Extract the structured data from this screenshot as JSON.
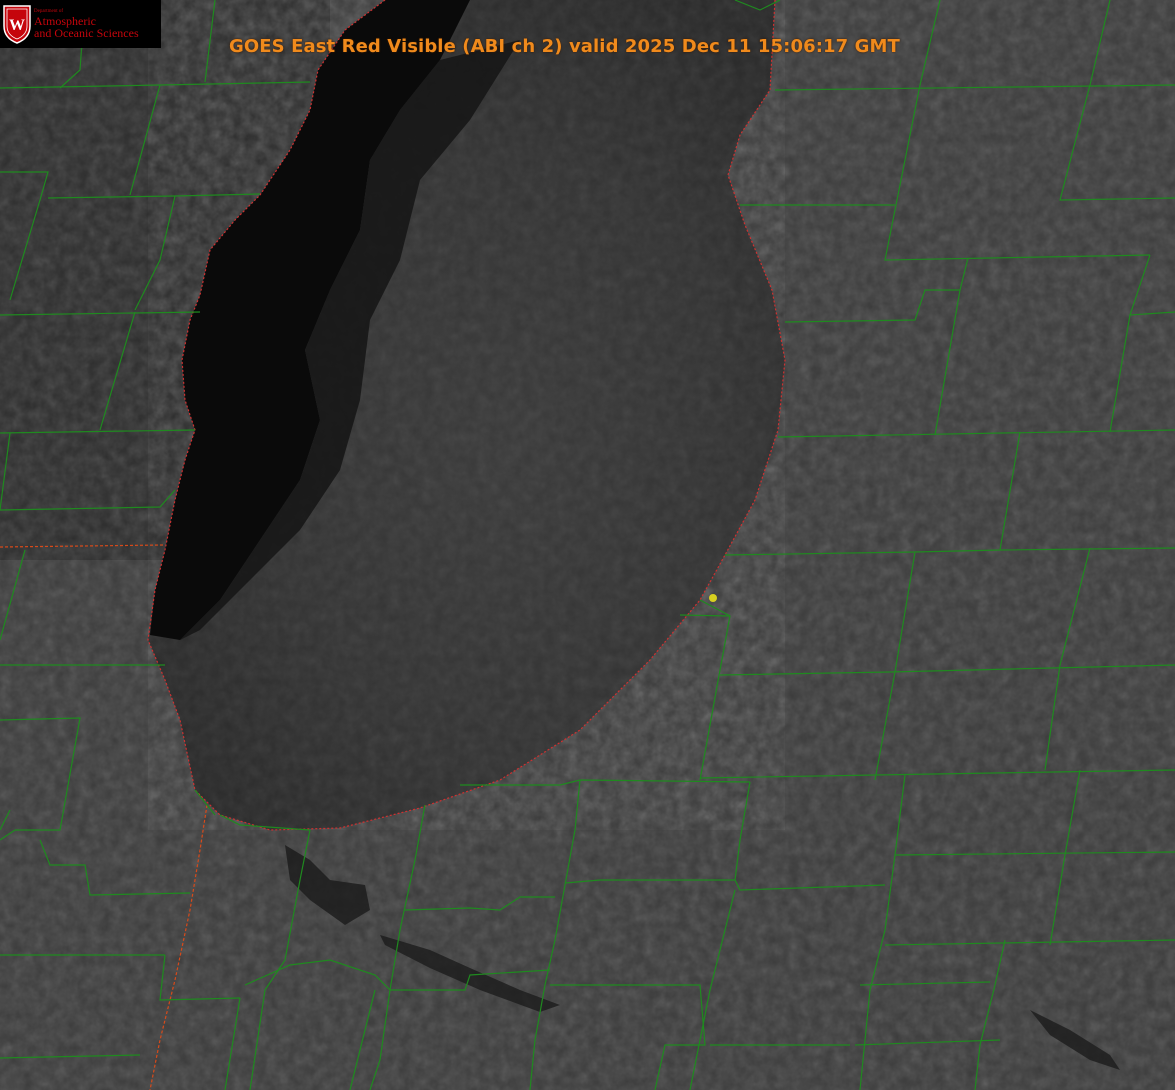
{
  "title": "GOES East Red Visible (ABI ch 2) valid 2025 Dec 11 15:06:17 GMT",
  "logo": {
    "department_line": "Department of",
    "name_line1": "Atmospheric",
    "name_line2": "and Oceanic Sciences",
    "shield_letter": "W",
    "icon": "uw-shield-icon"
  },
  "colors": {
    "title": "#f08a1c",
    "county_lines": "#1f8a1f",
    "state_lines": "#d84a1a",
    "lake_outline": "#d03030",
    "marker": "#d8d020",
    "logo_red": "#c5050c",
    "logo_text": "#c5050c",
    "land": "#3a3a3a",
    "lake": "#141414"
  },
  "marker": {
    "type": "point",
    "color": "#d8d020"
  }
}
